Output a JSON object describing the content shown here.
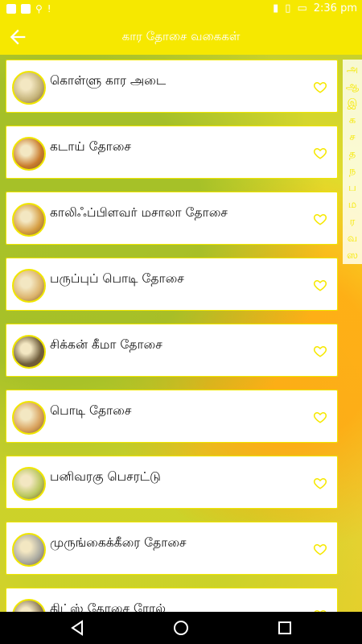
{
  "status": {
    "time": "2:36 pm"
  },
  "appbar": {
    "title": "கார தோசை வகைகள்"
  },
  "items": [
    {
      "name": "கொள்ளு கார அடை",
      "color": "#c4b278"
    },
    {
      "name": "கடாய் தோசை",
      "color": "#c97b2c"
    },
    {
      "name": "காலிஃப்பிளவர் மசாலா தோசை",
      "color": "#d59c3f"
    },
    {
      "name": "பருப்புப் பொடி தோசை",
      "color": "#dcb36c"
    },
    {
      "name": "சிக்கன் கீமா தோசை",
      "color": "#6e5c3a"
    },
    {
      "name": "பொடி தோசை",
      "color": "#d8a05a"
    },
    {
      "name": "பனிவரகு பெசரட்டு",
      "color": "#b8c65c"
    },
    {
      "name": "முருங்கைக்கீரை தோசை",
      "color": "#a8a8a0"
    },
    {
      "name": "கிட்ஸ் தோசை ரோல்",
      "color": "#8c7a5a"
    }
  ],
  "alphabet": [
    "அ",
    "ஆ",
    "இ",
    "க",
    "ச",
    "த",
    "ந",
    "ப",
    "ம",
    "ர",
    "வ",
    "ஸ"
  ],
  "colors": {
    "accent": "#f6e800",
    "heart": "#f6e800"
  }
}
